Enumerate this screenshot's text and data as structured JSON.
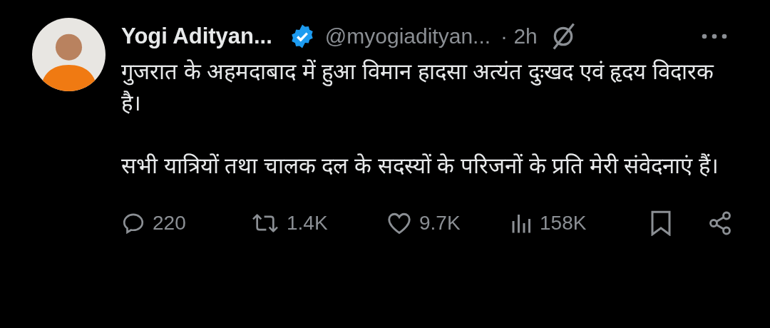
{
  "post": {
    "author": {
      "name": "Yogi Adityan...",
      "verified": true,
      "handle": "@myogiadityan...",
      "time": "· 2h"
    },
    "paragraphs": [
      "गुजरात के अहमदाबाद में हुआ विमान हादसा अत्यंत दुःखद एवं हृदय विदारक है।",
      "सभी यात्रियों तथा चालक दल के सदस्यों के परिजनों के प्रति मेरी संवेदनाएं हैं।"
    ],
    "actions": [
      {
        "kind": "reply",
        "count": "220"
      },
      {
        "kind": "repost",
        "count": "1.4K"
      },
      {
        "kind": "like",
        "count": "9.7K"
      },
      {
        "kind": "views",
        "count": "158K"
      },
      {
        "kind": "bookmark"
      },
      {
        "kind": "share"
      }
    ]
  }
}
